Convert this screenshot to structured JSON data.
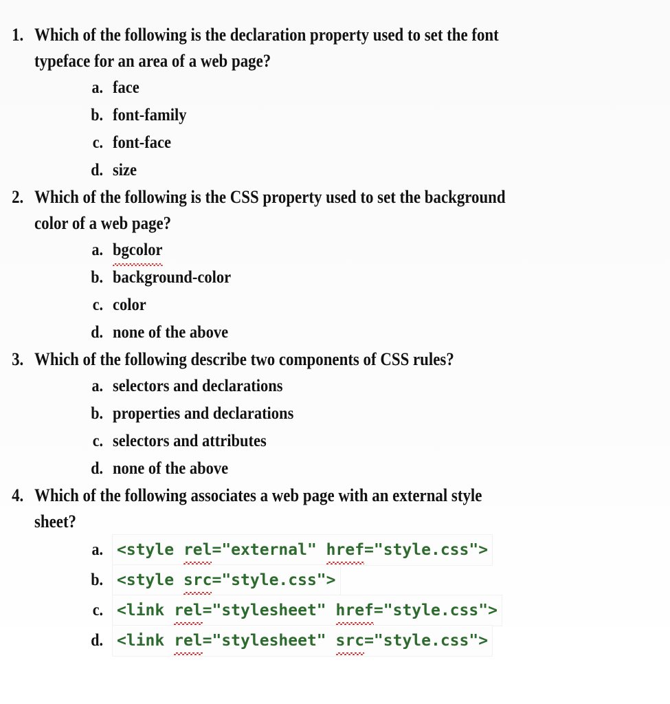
{
  "document": {
    "type": "multiple-choice-quiz",
    "topic": "CSS",
    "background_color": "#ffffff",
    "text_color": "#121212",
    "code_color": "#2d6a2d",
    "spellcheck_underline_color": "#e02020"
  },
  "questions": [
    {
      "number": "1.",
      "text": "Which of the following is the declaration property used to set the font typeface for an area of a web page?",
      "style": "plain",
      "options": [
        {
          "letter": "a.",
          "text": "face",
          "misspelled": ""
        },
        {
          "letter": "b.",
          "text": "font-family",
          "misspelled": ""
        },
        {
          "letter": "c.",
          "text": "font-face",
          "misspelled": ""
        },
        {
          "letter": "d.",
          "text": "size",
          "misspelled": ""
        }
      ]
    },
    {
      "number": "2.",
      "text": "Which of the following is the CSS property used to set the background color of a web page?",
      "style": "plain",
      "options": [
        {
          "letter": "a.",
          "text": "bgcolor",
          "misspelled": "bgcolor"
        },
        {
          "letter": "b.",
          "text": "background-color",
          "misspelled": ""
        },
        {
          "letter": "c.",
          "text": "color",
          "misspelled": ""
        },
        {
          "letter": "d.",
          "text": "none of the above",
          "misspelled": ""
        }
      ]
    },
    {
      "number": "3.",
      "text": "Which of the following describe two components of CSS rules?",
      "style": "plain",
      "options": [
        {
          "letter": "a.",
          "text": "selectors and declarations",
          "misspelled": ""
        },
        {
          "letter": "b.",
          "text": "properties and declarations",
          "misspelled": ""
        },
        {
          "letter": "c.",
          "text": "selectors and attributes",
          "misspelled": ""
        },
        {
          "letter": "d.",
          "text": "none of the above",
          "misspelled": ""
        }
      ]
    },
    {
      "number": "4.",
      "text": "Which of the following associates a web page with an external style sheet?",
      "style": "code",
      "options": [
        {
          "letter": "a.",
          "code_parts": [
            {
              "t": "<style ",
              "squiggly": false
            },
            {
              "t": "rel",
              "squiggly": true
            },
            {
              "t": "=\"external\" ",
              "squiggly": false
            },
            {
              "t": "href",
              "squiggly": true
            },
            {
              "t": "=\"style.css\">",
              "squiggly": false
            }
          ],
          "code_plain": "<style rel=\"external\" href=\"style.css\">"
        },
        {
          "letter": "b.",
          "code_parts": [
            {
              "t": "<style ",
              "squiggly": false
            },
            {
              "t": "src",
              "squiggly": true
            },
            {
              "t": "=\"style.css\">",
              "squiggly": false
            }
          ],
          "code_plain": "<style src=\"style.css\">"
        },
        {
          "letter": "c.",
          "code_parts": [
            {
              "t": "<link ",
              "squiggly": false
            },
            {
              "t": "rel",
              "squiggly": true
            },
            {
              "t": "=\"stylesheet\" ",
              "squiggly": false
            },
            {
              "t": "href",
              "squiggly": true
            },
            {
              "t": "=\"style.css\">",
              "squiggly": false
            }
          ],
          "code_plain": "<link rel=\"stylesheet\" href=\"style.css\">"
        },
        {
          "letter": "d.",
          "code_parts": [
            {
              "t": "<link ",
              "squiggly": false
            },
            {
              "t": "rel",
              "squiggly": true
            },
            {
              "t": "=\"stylesheet\" ",
              "squiggly": false
            },
            {
              "t": "src",
              "squiggly": true
            },
            {
              "t": "=\"style.css\">",
              "squiggly": false
            }
          ],
          "code_plain": "<link rel=\"stylesheet\" src=\"style.css\">"
        }
      ]
    }
  ]
}
